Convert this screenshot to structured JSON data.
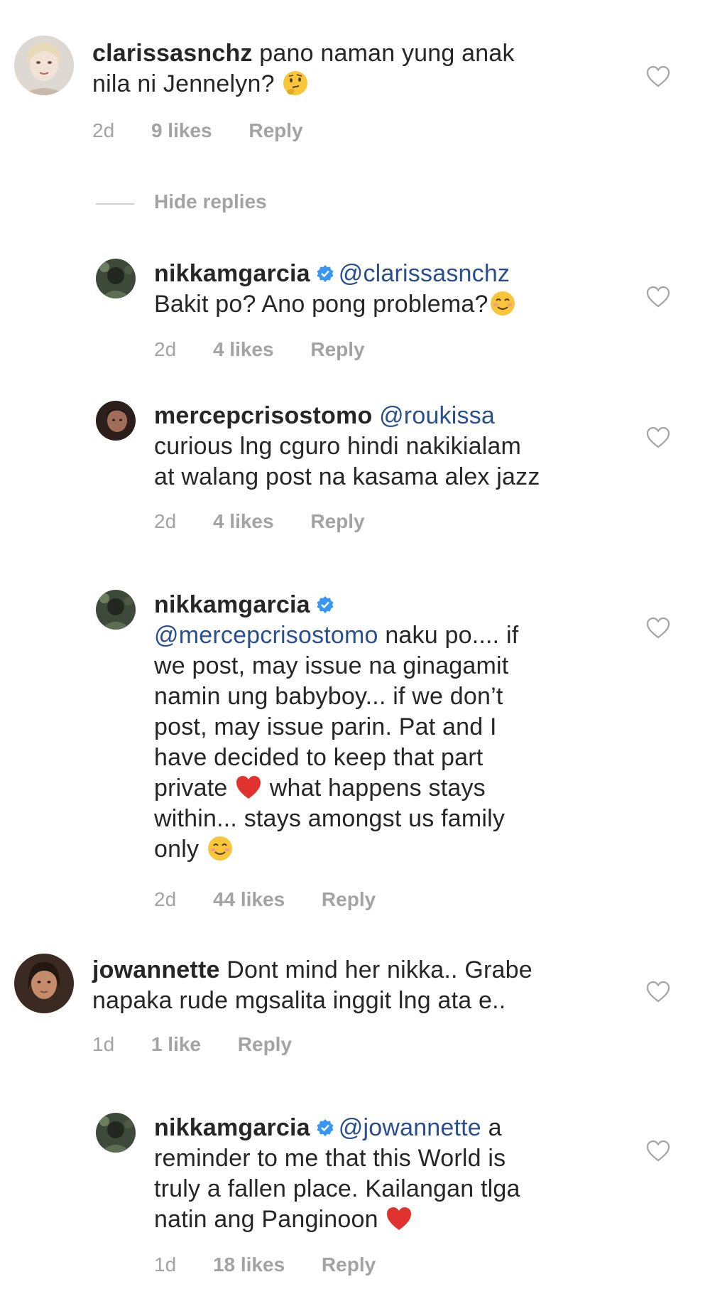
{
  "comments": [
    {
      "username": "clarissasnchz",
      "verified": false,
      "mention": "",
      "text_lines": [
        "pano naman yung anak",
        "nila ni Jennelyn?"
      ],
      "time": "2d",
      "likes": "9 likes",
      "reply": "Reply"
    },
    {
      "username": "nikkamgarcia",
      "verified": true,
      "mention": "@clarissasnchz",
      "text_lines": [
        "Bakit po? Ano pong problema?"
      ],
      "time": "2d",
      "likes": "4 likes",
      "reply": "Reply"
    },
    {
      "username": "mercepcrisostomo",
      "verified": false,
      "mention": "@roukissa",
      "text_lines": [
        "curious lng cguro hindi nakikialam",
        "at walang post na kasama alex jazz"
      ],
      "time": "2d",
      "likes": "4 likes",
      "reply": "Reply"
    },
    {
      "username": "nikkamgarcia",
      "verified": true,
      "mention": "@mercepcrisostomo",
      "text_lines": [
        "naku po.... if",
        "we post, may issue na ginagamit",
        "namin ung babyboy... if we don’t",
        "post, may issue parin. Pat and I",
        "have decided to keep that part",
        "private",
        "what happens stays",
        "within... stays amongst us family",
        "only"
      ],
      "time": "2d",
      "likes": "44 likes",
      "reply": "Reply"
    },
    {
      "username": "jowannette",
      "verified": false,
      "mention": "",
      "text_lines": [
        "Dont mind her nikka.. Grabe",
        "napaka rude mgsalita inggit lng ata e.."
      ],
      "time": "1d",
      "likes": "1 like",
      "reply": "Reply"
    },
    {
      "username": "nikkamgarcia",
      "verified": true,
      "mention": "@jowannette",
      "text_lines": [
        "a",
        "reminder to me that this World is",
        "truly a fallen place. Kailangan tlga",
        "natin ang Panginoon"
      ],
      "time": "1d",
      "likes": "18 likes",
      "reply": "Reply"
    }
  ],
  "hide_replies": "Hide replies",
  "icons": {
    "like": "heart-outline-icon",
    "verified": "verified-badge-icon",
    "thinking": "thinking-face-emoji",
    "smile": "smiling-face-emoji",
    "heart_red": "red-heart-emoji"
  },
  "colors": {
    "verified": "#3897f0",
    "mention": "#2a4f8f",
    "meta": "#a3a3a3",
    "heart_red": "#e0322f"
  }
}
